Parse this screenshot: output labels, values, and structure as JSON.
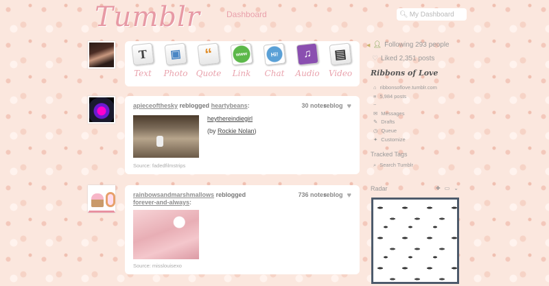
{
  "header": {
    "logo": "Tumblr",
    "nav_dashboard": "Dashboard",
    "search_placeholder": "My Dashboard"
  },
  "post_types": [
    {
      "label": "Text",
      "glyph": "T"
    },
    {
      "label": "Photo",
      "glyph": "▣"
    },
    {
      "label": "Quote",
      "glyph": "“"
    },
    {
      "label": "Link",
      "glyph": "www"
    },
    {
      "label": "Chat",
      "glyph": "Hi!"
    },
    {
      "label": "Audio",
      "glyph": "♫"
    },
    {
      "label": "Video",
      "glyph": "▤"
    }
  ],
  "posts": [
    {
      "user": "apieceofthesky",
      "action": "reblogged",
      "source_user": "heartybeans",
      "notes": "30 notes",
      "reblog": "reblog",
      "caption_link": "heythereindiegirl",
      "caption_by_prefix": "(by ",
      "caption_by_name": "Rockie Nolan",
      "caption_by_suffix": ")",
      "source": "Source: fadedfilmstrips"
    },
    {
      "user": "rainbowsandmarshmallows",
      "action": "reblogged",
      "source_user": "forever-and-always",
      "notes": "736 notes",
      "reblog": "reblog",
      "source": "Source: misslouisexo"
    }
  ],
  "sidebar": {
    "following": "Following 293 people",
    "liked": "Liked 2,351 posts",
    "blog_title": "Ribbons of Love",
    "blog_url": "ribbonsoflove.tumblr.com",
    "posts_count": "5,984 posts",
    "tilde": "~",
    "messages": "Messages",
    "drafts": "Drafts",
    "queue": "Queue",
    "customize": "Customize",
    "tracked_tags": "Tracked Tags",
    "search_tumblr": "Search Tumblr",
    "radar": "Radar"
  },
  "colors": {
    "accent_pink": "#e79aa5",
    "background": "#fbe7de",
    "radar_border": "#4c5a6b"
  }
}
